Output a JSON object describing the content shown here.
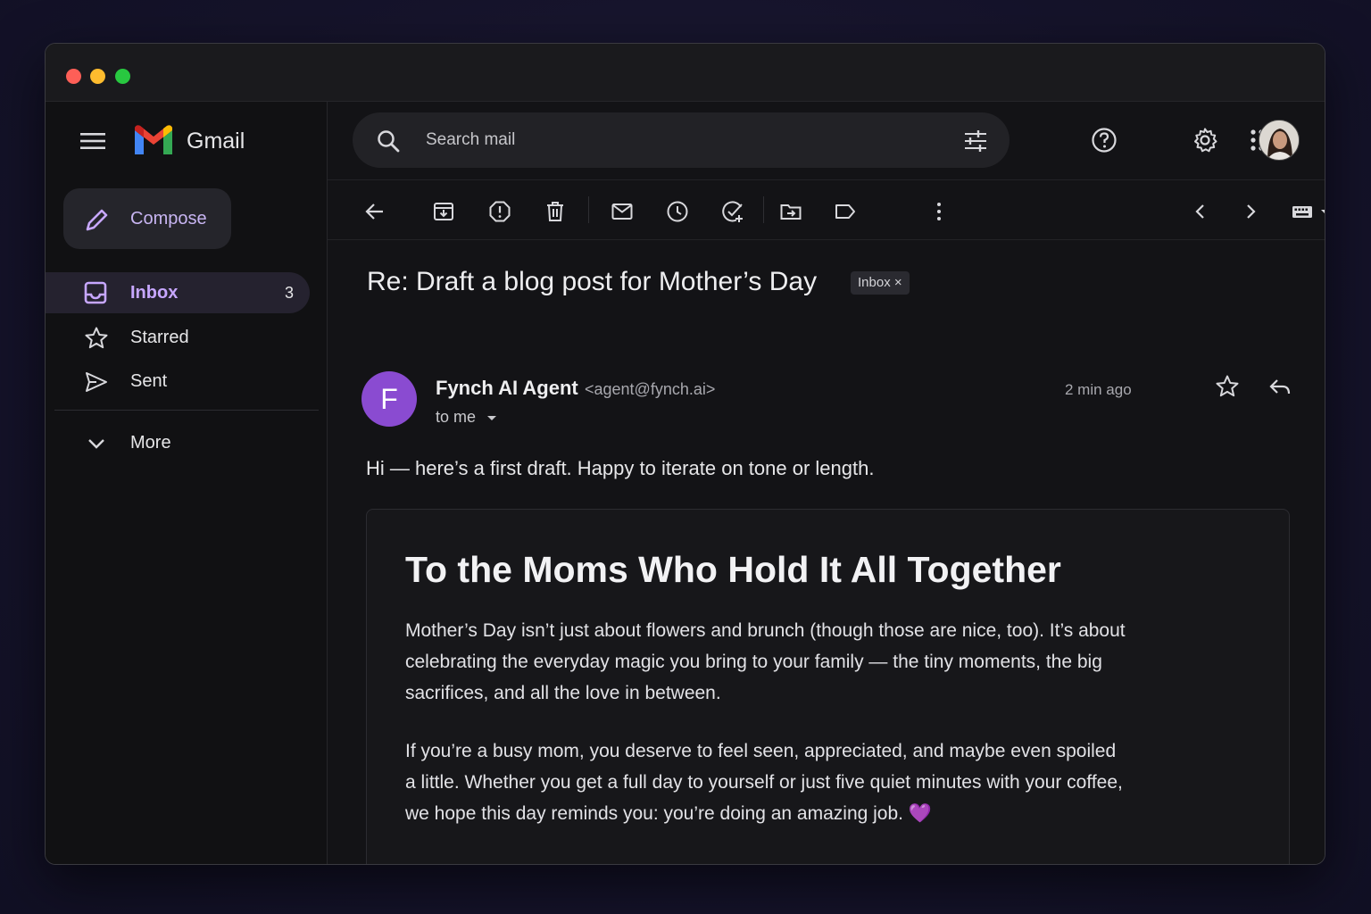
{
  "app": {
    "name": "Gmail"
  },
  "sidebar": {
    "compose_label": "Compose",
    "items": [
      {
        "label": "Inbox",
        "count": "3",
        "active": true
      },
      {
        "label": "Starred",
        "count": ""
      },
      {
        "label": "Sent",
        "count": ""
      }
    ],
    "more_label": "More"
  },
  "search": {
    "placeholder": "Search mail"
  },
  "email": {
    "subject": "Re: Draft a blog post for Mother’s Day",
    "label_chip": "Inbox",
    "chip_close": "×",
    "sender_initial": "F",
    "sender_name": "Fynch AI Agent",
    "sender_email": "<agent@fynch.ai>",
    "recipient": "to me",
    "time": "2 min ago",
    "greeting": "Hi — here’s a first draft. Happy to iterate on tone or length.",
    "blog": {
      "title": "To the Moms Who Hold It All Together",
      "paragraph_1": "Mother’s Day isn’t just about flowers and brunch (though those are nice, too). It’s about celebrating the everyday magic you bring to your family — the tiny moments, the big sacrifices, and all the love in between.",
      "paragraph_2": "If you’re a busy mom, you deserve to feel seen, appreciated, and maybe even spoiled a little. Whether you get a full day to yourself or just five quiet minutes with your coffee, we hope this day reminds you: you’re doing an amazing job.",
      "emoji": "💜"
    }
  },
  "colors": {
    "accent": "#c7a7ff",
    "avatar_bg": "#8a4bd1"
  },
  "icons": [
    "menu-icon",
    "search-icon",
    "filter-icon",
    "help-icon",
    "settings-icon",
    "apps-icon",
    "back-icon",
    "archive-icon",
    "report-spam-icon",
    "delete-icon",
    "mark-unread-icon",
    "snooze-icon",
    "add-task-icon",
    "move-to-icon",
    "label-icon",
    "more-vert-icon",
    "prev-icon",
    "next-icon",
    "keyboard-icon",
    "star-icon",
    "reply-icon"
  ]
}
